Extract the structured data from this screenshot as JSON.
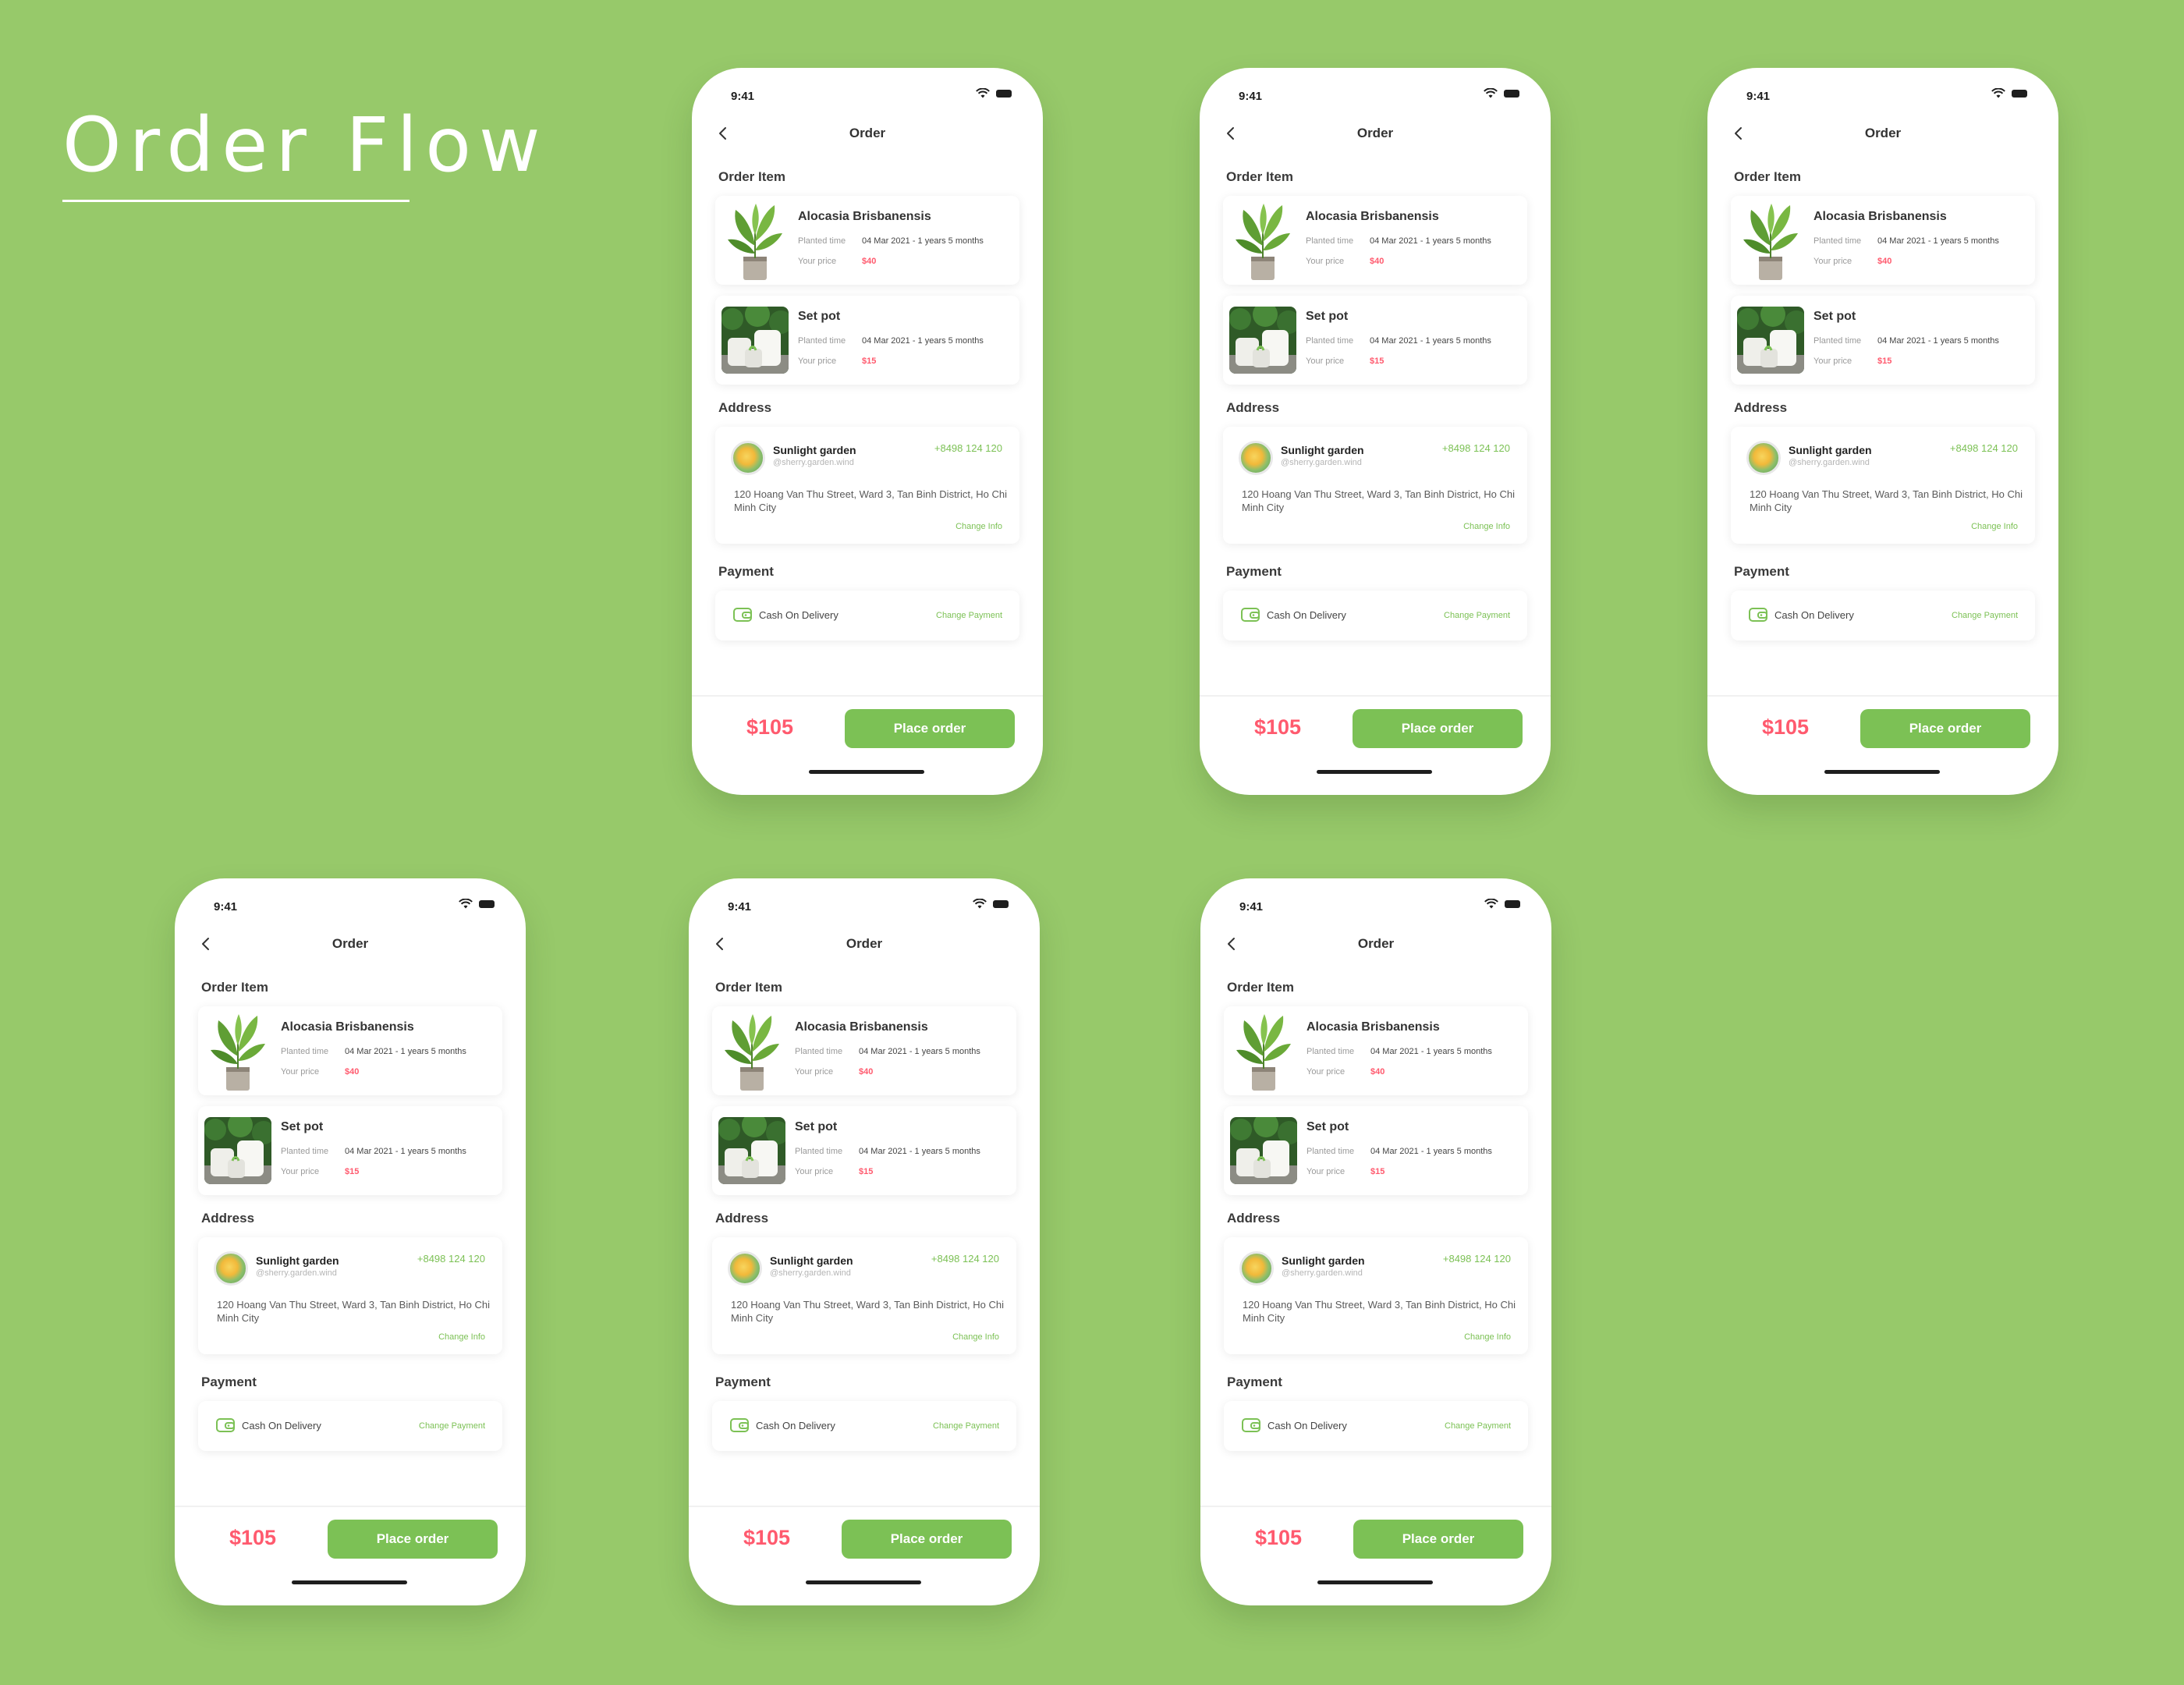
{
  "page": {
    "title": "Order Flow"
  },
  "colors": {
    "background": "#97c96a",
    "accent": "#7cc155",
    "price": "#ff5a6e",
    "card": "#ffffff"
  },
  "phone": {
    "status_time": "9:41",
    "nav_title": "Order",
    "sections": {
      "order_item": "Order Item",
      "address": "Address",
      "payment": "Payment"
    },
    "items": [
      {
        "name": "Alocasia Brisbanensis",
        "planted_label": "Planted time",
        "planted_value": "04 Mar 2021 - 1 years 5 months",
        "price_label": "Your price",
        "price": "$40",
        "thumb_icon": "plant-image"
      },
      {
        "name": "Set pot",
        "planted_label": "Planted time",
        "planted_value": "04 Mar 2021 - 1 years 5 months",
        "price_label": "Your price",
        "price": "$15",
        "thumb_icon": "pot-image"
      }
    ],
    "address": {
      "name": "Sunlight garden",
      "handle": "@sherry.garden.wind",
      "phone": "+8498 124 120",
      "text": "120 Hoang Van Thu Street, Ward 3, Tan Binh District, Ho Chi Minh City",
      "change_label": "Change Info"
    },
    "payment": {
      "method": "Cash On Delivery",
      "change_label": "Change Payment",
      "icon": "wallet-icon"
    },
    "total": "$105",
    "place_order": "Place order"
  }
}
